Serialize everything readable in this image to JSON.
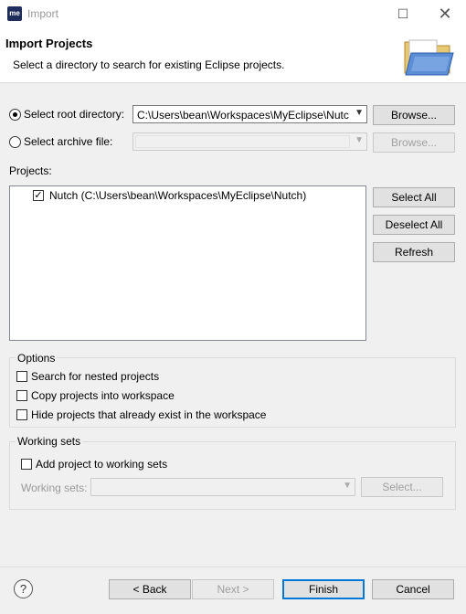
{
  "window": {
    "icon_text": "me",
    "title": "Import"
  },
  "header": {
    "title": "Import Projects",
    "description": "Select a directory to search for existing Eclipse projects."
  },
  "source": {
    "root_label": "Select root directory:",
    "root_value": "C:\\Users\\bean\\Workspaces\\MyEclipse\\Nutc",
    "browse_label": "Browse...",
    "archive_label": "Select archive file:",
    "archive_browse_label": "Browse..."
  },
  "projects": {
    "label": "Projects:",
    "items": [
      {
        "label": "Nutch (C:\\Users\\bean\\Workspaces\\MyEclipse\\Nutch)",
        "checked": true
      }
    ],
    "select_all": "Select All",
    "deselect_all": "Deselect All",
    "refresh": "Refresh"
  },
  "options": {
    "title": "Options",
    "nested": "Search for nested projects",
    "copy": "Copy projects into workspace",
    "hide": "Hide projects that already exist in the workspace"
  },
  "working_sets": {
    "title": "Working sets",
    "add": "Add project to working sets",
    "label": "Working sets:",
    "select": "Select..."
  },
  "footer": {
    "help": "?",
    "back": "< Back",
    "next": "Next >",
    "finish": "Finish",
    "cancel": "Cancel"
  }
}
